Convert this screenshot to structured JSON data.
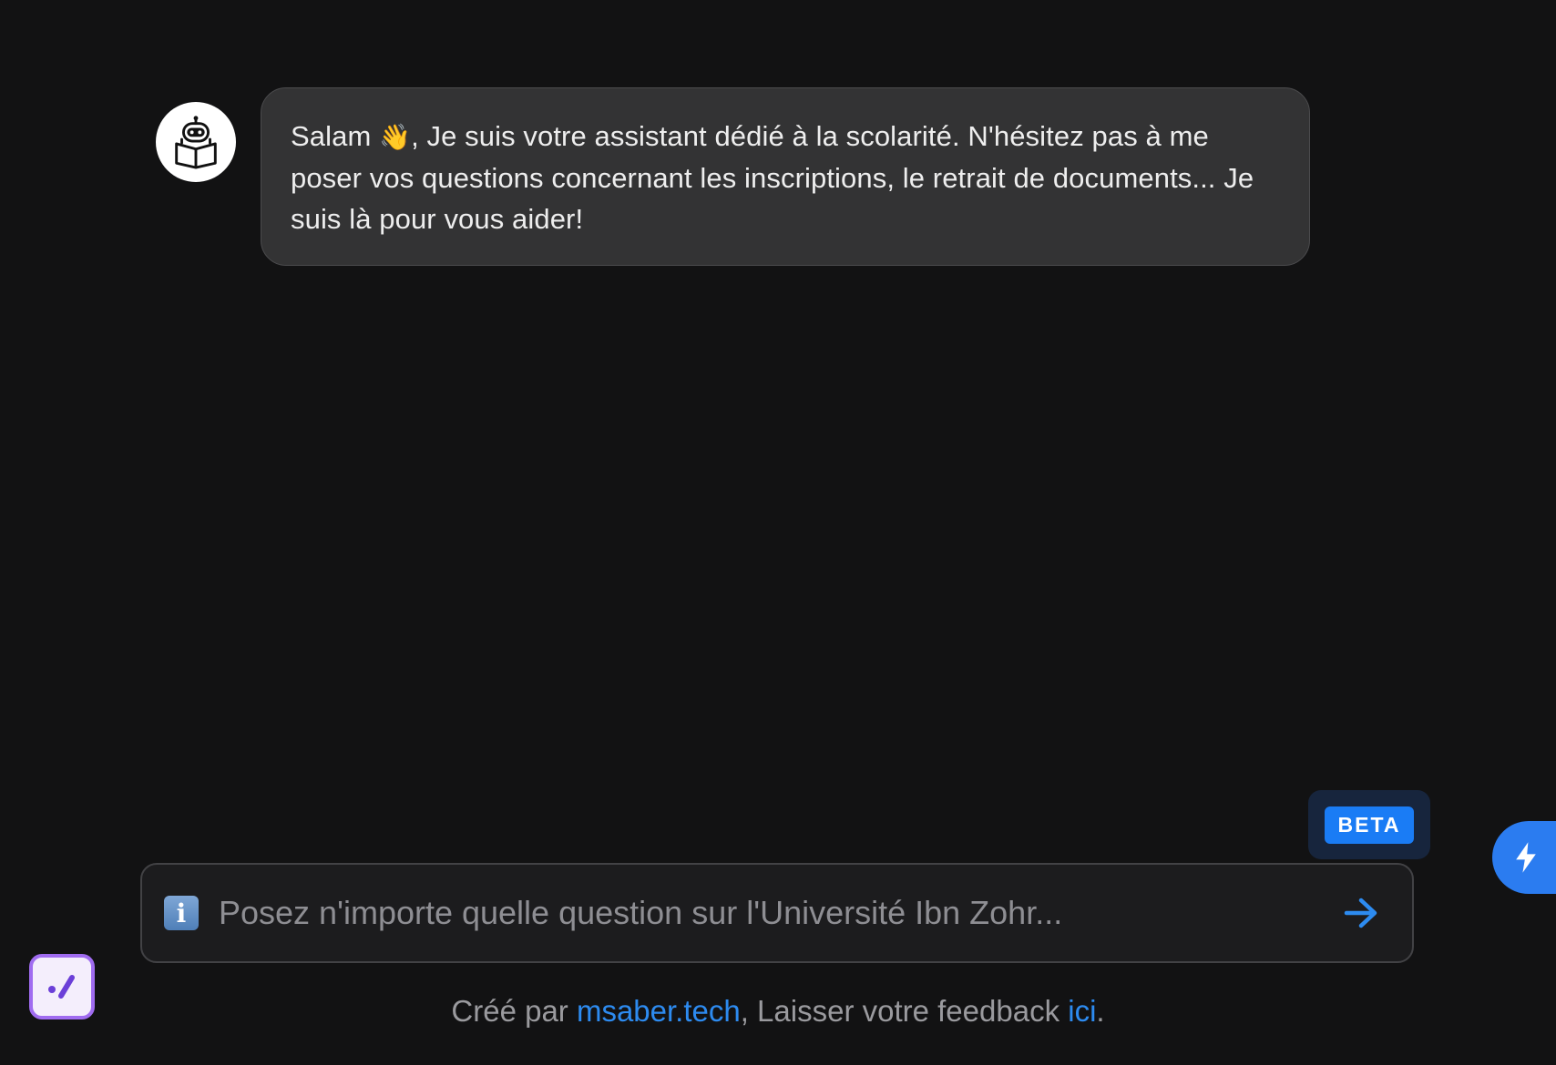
{
  "chat": {
    "greeting": "Salam",
    "wave_emoji": "👋",
    "message_rest": ", Je suis votre assistant dédié à la scolarité. N'hésitez pas à me poser vos questions concernant les inscriptions, le retrait de documents... Je suis là pour vous aider!",
    "avatar_icon": "robot-reading-book-icon"
  },
  "badge": {
    "label": "BETA"
  },
  "input": {
    "info_icon_glyph": "i",
    "placeholder": "Posez n'importe quelle question sur l'Université Ibn Zohr...",
    "value": "",
    "send_icon": "arrow-right-icon"
  },
  "footer": {
    "prefix": "Créé par ",
    "author_link": "msaber.tech",
    "middle": ", Laisser votre feedback ",
    "feedback_link": "ici",
    "suffix": "."
  },
  "colors": {
    "background": "#121213",
    "bubble": "#333334",
    "accent": "#1a7cf5",
    "link": "#2d8bf0",
    "widget_border": "#a06cf0"
  }
}
